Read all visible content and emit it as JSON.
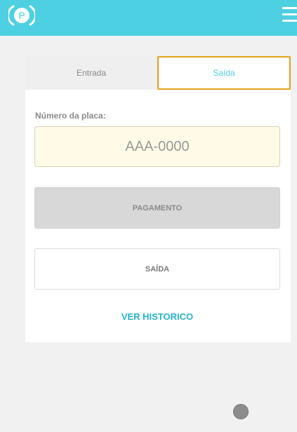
{
  "colors": {
    "header_bg": "#4dd0e1",
    "active_tab_border": "#e0a21b",
    "active_tab_text": "#4dd0e1",
    "input_bg": "#fffbe6",
    "link": "#26b3c8",
    "page_bg": "#f1f1f1"
  },
  "header": {
    "logo_icon": "parking-p-icon",
    "logo_letter": "P",
    "menu_icon": "hamburger-menu-icon"
  },
  "tabs": [
    {
      "label": "Entrada",
      "active": false
    },
    {
      "label": "Saída",
      "active": true
    }
  ],
  "form": {
    "plate_label": "Número da placa:",
    "plate_placeholder": "AAA-0000",
    "plate_value": ""
  },
  "buttons": {
    "payment_label": "PAGAMENTO",
    "exit_label": "SAÍDA"
  },
  "history_link_label": "VER HISTORICO"
}
